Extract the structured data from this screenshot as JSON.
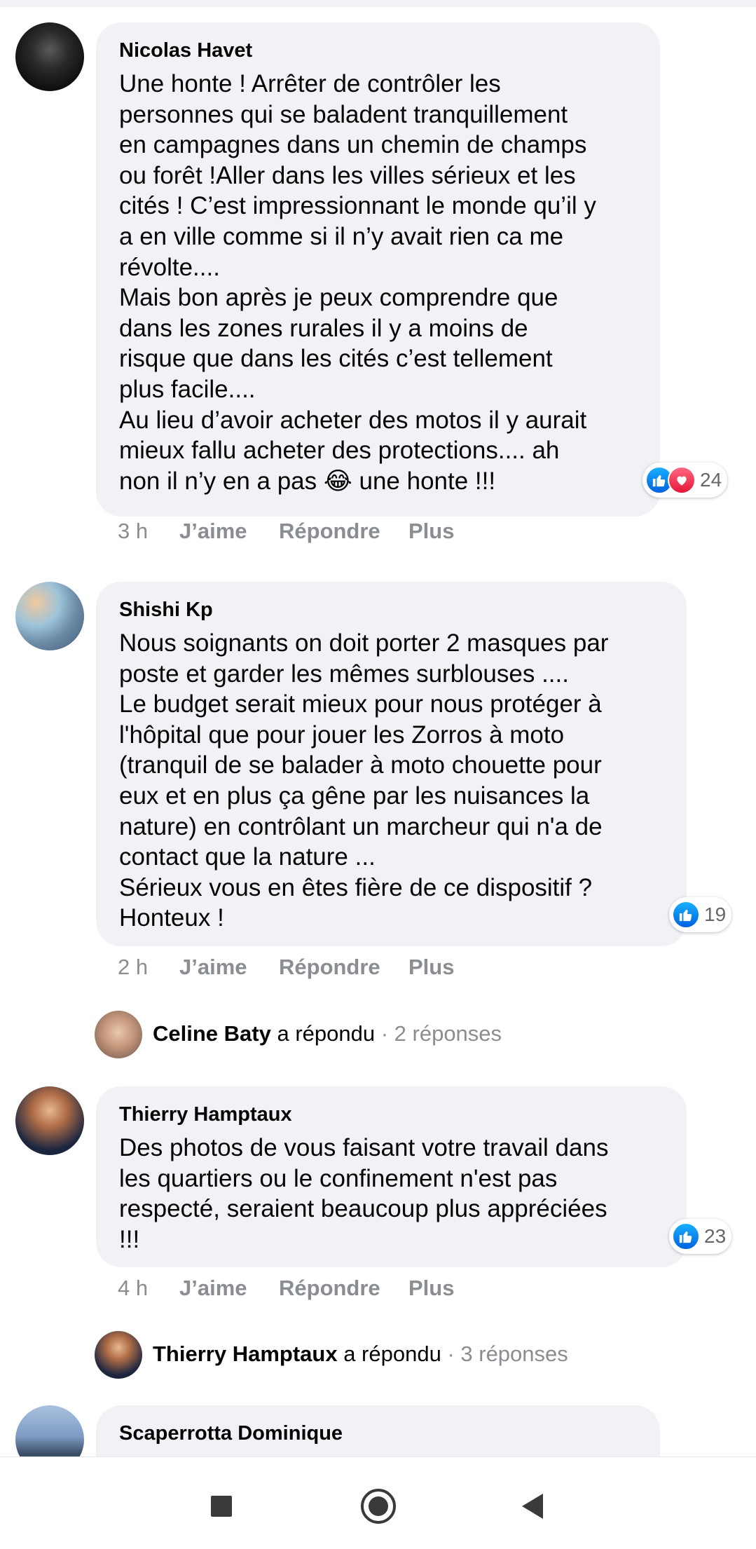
{
  "comments": [
    {
      "author": "Nicolas Havet",
      "text": "Une honte ! Arrêter de contrôler les\npersonnes qui se baladent tranquillement\nen campagnes dans un chemin de champs\nou forêt !Aller dans les villes sérieux et les\ncités ! C’est impressionnant le monde qu’il y\na en ville comme si il n’y avait rien ca me\nrévolte....\nMais bon après je peux comprendre que\ndans les zones rurales il y a moins de\nrisque que dans les cités c’est tellement\nplus facile....\nAu lieu d’avoir acheter des motos il y aurait\nmieux fallu acheter des protections.... ah\nnon il n’y en a pas 😂 une honte !!!",
      "reaction_count": "24",
      "time": "3 h",
      "like_label": "J’aime",
      "reply_label": "Répondre",
      "more_label": "Plus"
    },
    {
      "author": "Shishi Kp",
      "text": "Nous soignants on doit porter 2 masques par\nposte et garder les mêmes surblouses ....\nLe budget serait mieux pour nous protéger à\nl'hôpital que pour jouer les Zorros à moto\n(tranquil de se balader à moto chouette pour\neux et en plus ça gêne par les nuisances la\nnature) en contrôlant un marcheur qui n'a de\ncontact que la nature ...\nSérieux vous en êtes fière de ce dispositif ?\nHonteux !",
      "reaction_count": "19",
      "time": "2 h",
      "like_label": "J’aime",
      "reply_label": "Répondre",
      "more_label": "Plus",
      "reply_summary": {
        "name": "Celine Baty",
        "verb": "a répondu",
        "count": "· 2 réponses"
      }
    },
    {
      "author": "Thierry Hamptaux",
      "text": "Des photos de vous faisant votre travail dans\nles quartiers ou le confinement n'est pas\nrespecté, seraient beaucoup plus appréciées\n!!!",
      "reaction_count": "23",
      "time": "4 h",
      "like_label": "J’aime",
      "reply_label": "Répondre",
      "more_label": "Plus",
      "reply_summary": {
        "name": "Thierry Hamptaux",
        "verb": "a répondu",
        "count": "· 3 réponses"
      }
    },
    {
      "author": "Scaperrotta Dominique"
    }
  ],
  "navigation": {
    "recent_icon": "square-icon",
    "home_icon": "circle-home-icon",
    "back_icon": "triangle-back-icon"
  },
  "colors": {
    "bubble": "#f0f2f5",
    "like_blue": "#1877f2",
    "love_red": "#f02849",
    "meta_gray": "#8a8d91"
  }
}
